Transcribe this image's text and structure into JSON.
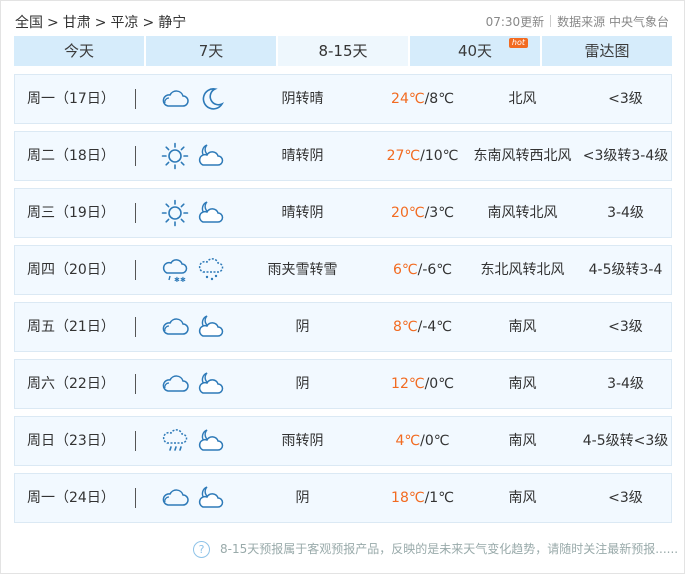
{
  "breadcrumb": [
    "全国",
    "甘肃",
    "平凉",
    "静宁"
  ],
  "meta": {
    "updated": "07:30更新",
    "source": "数据来源 中央气象台"
  },
  "tabs": [
    {
      "label": "今天",
      "active": false,
      "hot": ""
    },
    {
      "label": "7天",
      "active": false,
      "hot": ""
    },
    {
      "label": "8-15天",
      "active": true,
      "hot": ""
    },
    {
      "label": "40天",
      "active": false,
      "hot": "hot"
    },
    {
      "label": "雷达图",
      "active": false,
      "hot": ""
    }
  ],
  "days": [
    {
      "day": "周一（17日）",
      "icons": [
        "cloud-icon",
        "moon-icon"
      ],
      "desc": "阴转晴",
      "hi": "24℃",
      "lo": "/8℃",
      "wind": "北风",
      "level": "<3级"
    },
    {
      "day": "周二（18日）",
      "icons": [
        "sun-icon",
        "cloudy-night-icon"
      ],
      "desc": "晴转阴",
      "hi": "27℃",
      "lo": "/10℃",
      "wind": "东南风转西北风",
      "level": "<3级转3-4级"
    },
    {
      "day": "周三（19日）",
      "icons": [
        "sun-icon",
        "cloudy-night-icon"
      ],
      "desc": "晴转阴",
      "hi": "20℃",
      "lo": "/3℃",
      "wind": "南风转北风",
      "level": "3-4级"
    },
    {
      "day": "周四（20日）",
      "icons": [
        "sleet-icon",
        "snow-icon"
      ],
      "desc": "雨夹雪转雪",
      "hi": "6℃",
      "lo": "/-6℃",
      "wind": "东北风转北风",
      "level": "4-5级转3-4"
    },
    {
      "day": "周五（21日）",
      "icons": [
        "cloud-icon",
        "cloudy-night-icon"
      ],
      "desc": "阴",
      "hi": "8℃",
      "lo": "/-4℃",
      "wind": "南风",
      "level": "<3级"
    },
    {
      "day": "周六（22日）",
      "icons": [
        "cloud-icon",
        "cloudy-night-icon"
      ],
      "desc": "阴",
      "hi": "12℃",
      "lo": "/0℃",
      "wind": "南风",
      "level": "3-4级"
    },
    {
      "day": "周日（23日）",
      "icons": [
        "rain-icon",
        "cloudy-night-icon"
      ],
      "desc": "雨转阴",
      "hi": "4℃",
      "lo": "/0℃",
      "wind": "南风",
      "level": "4-5级转<3级"
    },
    {
      "day": "周一（24日）",
      "icons": [
        "cloud-icon",
        "cloudy-night-icon"
      ],
      "desc": "阴",
      "hi": "18℃",
      "lo": "/1℃",
      "wind": "南风",
      "level": "<3级"
    }
  ],
  "footer": {
    "note": "8-15天预报属于客观预报产品，反映的是未来天气变化趋势，请随时关注最新预报......"
  },
  "colors": {
    "accent": "#f26b21",
    "tab_bg": "#d6ecfb",
    "row_bg": "#f2f9ff",
    "icon": "#2e7ab8"
  }
}
